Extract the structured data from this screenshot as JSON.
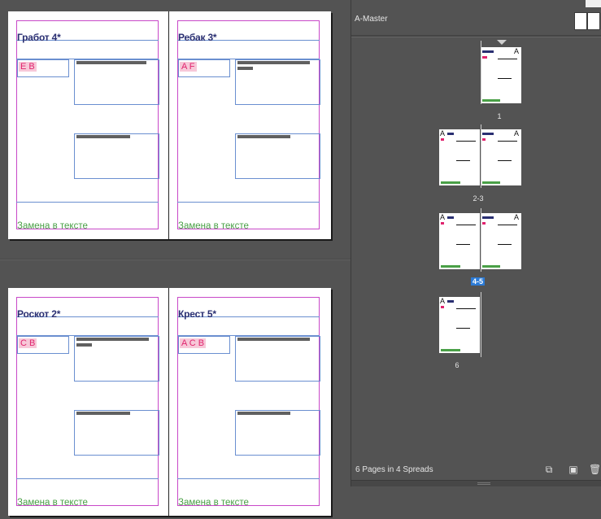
{
  "spreads": [
    {
      "left": {
        "title": "Гработ 4*",
        "tags": "E B",
        "bar1_width": 86,
        "has_short_bar": false,
        "bar2_width": 66,
        "footer": "Замена в тексте"
      },
      "right": {
        "title": "Ребак 3*",
        "tags": "A F",
        "bar1_width": 89,
        "has_short_bar": true,
        "bar2_width": 65,
        "footer": "Замена в тексте"
      }
    },
    {
      "left": {
        "title": "Роскот 2*",
        "tags": "C B",
        "bar1_width": 89,
        "has_short_bar": true,
        "bar2_width": 66,
        "footer": "Замена в тексте"
      },
      "right": {
        "title": "Крест 5*",
        "tags": "A C B",
        "bar1_width": 89,
        "has_short_bar": false,
        "bar2_width": 65,
        "footer": "Замена в тексте"
      }
    }
  ],
  "panel": {
    "master_label": "A-Master",
    "spread_labels": [
      "1",
      "2-3",
      "4-5",
      "6"
    ],
    "selected_spread": "4-5",
    "thumb_letter": "A",
    "footer_status": "6 Pages in 4 Spreads",
    "icons": {
      "edit_page_size": "page-size-icon",
      "new_page": "new-page-icon",
      "delete": "trash-icon"
    }
  },
  "colors": {
    "title": "#2a2f72",
    "tag_text": "#e0246e",
    "tag_bg": "#f7c8d8",
    "footer_text": "#4aa047",
    "margin": "#c848c8",
    "guide": "#6a8fd0",
    "selected": "#2c7bd6"
  }
}
